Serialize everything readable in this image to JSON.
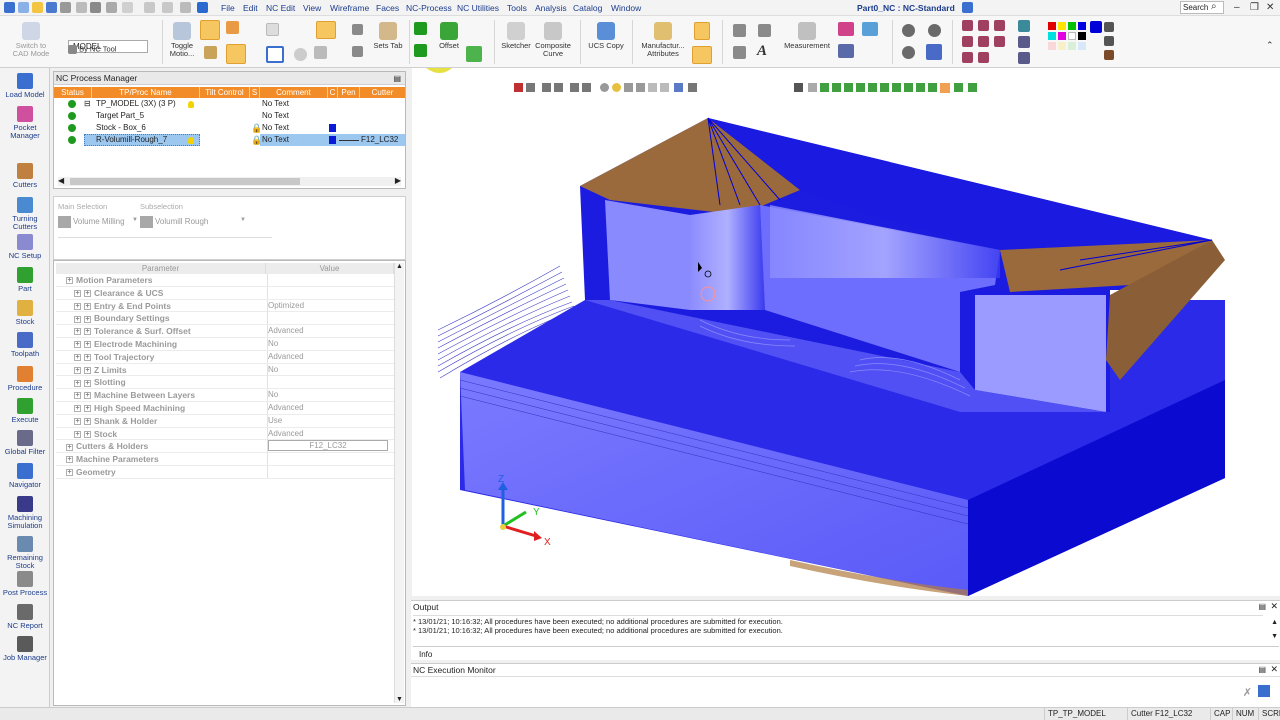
{
  "window": {
    "title": "Part0_NC : NC-Standard",
    "search_placeholder": "Search"
  },
  "menu": [
    "File",
    "Edit",
    "NC Edit",
    "View",
    "Wireframe",
    "Faces",
    "NC-Process",
    "NC Utilities",
    "Tools",
    "Analysis",
    "Catalog",
    "Window"
  ],
  "ribbon": {
    "switch_label": "Switch to CAD Mode",
    "model_combo": "MODEL",
    "by_nc_tool": "By NC Tool",
    "toggle_motion": "Toggle Motio...",
    "sets_tab": "Sets Tab",
    "offset": "Offset",
    "sketcher": "Sketcher",
    "composite_curve": "Composite Curve",
    "ucs_copy": "UCS Copy",
    "manufacturing_attributes": "Manufactur... Attributes",
    "measurement": "Measurement"
  },
  "left_toolbar": [
    {
      "label": "Load Model",
      "icon": "load-model-icon"
    },
    {
      "label": "Pocket Manager",
      "icon": "pocket-manager-icon"
    },
    {
      "label": "Cutters",
      "icon": "cutters-icon"
    },
    {
      "label": "Turning Cutters",
      "icon": "turning-cutters-icon"
    },
    {
      "label": "NC Setup",
      "icon": "nc-setup-icon"
    },
    {
      "label": "Part",
      "icon": "part-icon"
    },
    {
      "label": "Stock",
      "icon": "stock-icon"
    },
    {
      "label": "Toolpath",
      "icon": "toolpath-icon"
    },
    {
      "label": "Procedure",
      "icon": "procedure-icon"
    },
    {
      "label": "Execute",
      "icon": "execute-icon"
    },
    {
      "label": "Global Filter",
      "icon": "global-filter-icon"
    },
    {
      "label": "Navigator",
      "icon": "navigator-icon"
    },
    {
      "label": "Machining Simulation",
      "icon": "machining-simulation-icon"
    },
    {
      "label": "Remaining Stock",
      "icon": "remaining-stock-icon"
    },
    {
      "label": "Post Process",
      "icon": "post-process-icon"
    },
    {
      "label": "NC Report",
      "icon": "nc-report-icon"
    },
    {
      "label": "Job Manager",
      "icon": "job-manager-icon"
    }
  ],
  "process_manager": {
    "title": "NC Process Manager",
    "columns": [
      "Status",
      "TP/Proc Name",
      "Tilt Control",
      "S",
      "Comment",
      "C",
      "Pen",
      "Cutter"
    ],
    "rows": [
      {
        "name": "TP_MODEL (3X) (3 P)",
        "comment": "No Text",
        "cutter": ""
      },
      {
        "name": "Target Part_5",
        "comment": "No Text",
        "cutter": ""
      },
      {
        "name": "Stock - Box_6",
        "comment": "No Text",
        "cutter": ""
      },
      {
        "name": "R-Volumill-Rough_7",
        "comment": "No Text",
        "cutter": "F12_LC32"
      }
    ]
  },
  "selection": {
    "main_label": "Main Selection",
    "main_value": "Volume Milling",
    "sub_label": "Subselection",
    "sub_value": "Volumill Rough"
  },
  "params": {
    "header_param": "Parameter",
    "header_value": "Value",
    "rows": [
      {
        "name": "Motion Parameters",
        "value": "",
        "level": 0,
        "bold": true
      },
      {
        "name": "Clearance & UCS",
        "value": "",
        "level": 1,
        "bold": true
      },
      {
        "name": "Entry & End Points",
        "value": "Optimized",
        "level": 1,
        "bold": true
      },
      {
        "name": "Boundary Settings",
        "value": "",
        "level": 1,
        "bold": true
      },
      {
        "name": "Tolerance & Surf. Offset",
        "value": "Advanced",
        "level": 1,
        "bold": true
      },
      {
        "name": "Electrode Machining",
        "value": "No",
        "level": 1,
        "bold": true
      },
      {
        "name": "Tool Trajectory",
        "value": "Advanced",
        "level": 1,
        "bold": true
      },
      {
        "name": "Z Limits",
        "value": "No",
        "level": 1,
        "bold": true
      },
      {
        "name": "Slotting",
        "value": "",
        "level": 1,
        "bold": true
      },
      {
        "name": "Machine Between Layers",
        "value": "No",
        "level": 1,
        "bold": true
      },
      {
        "name": "High Speed Machining",
        "value": "Advanced",
        "level": 1,
        "bold": true
      },
      {
        "name": "Shank & Holder",
        "value": "Use",
        "level": 1,
        "bold": true
      },
      {
        "name": "Stock",
        "value": "Advanced",
        "level": 1,
        "bold": true
      },
      {
        "name": "Cutters & Holders",
        "value": "F12_LC32",
        "level": 0,
        "bold": true
      },
      {
        "name": "Machine Parameters",
        "value": "",
        "level": 0,
        "bold": true
      },
      {
        "name": "Geometry",
        "value": "",
        "level": 0,
        "bold": true
      }
    ]
  },
  "viewport": {
    "axis_x": "X",
    "axis_y": "Y",
    "axis_z": "Z"
  },
  "output": {
    "title": "Output",
    "lines": [
      "* 13/01/21; 10:16:32; All procedures have been executed; no additional procedures are submitted for execution.",
      "* 13/01/21; 10:16:32; All procedures have been executed; no additional procedures are submitted for execution."
    ],
    "tab": "Info"
  },
  "exec_monitor": {
    "title": "NC Execution Monitor"
  },
  "status": {
    "tp": "TP_TP_MODEL",
    "cutter": "Cutter F12_LC32",
    "cap": "CAP",
    "num": "NUM",
    "scrl": "SCRL"
  },
  "colors": {
    "accent": "#f28c28",
    "part_blue": "#0a0ad8",
    "stock_brown": "#9a6a3c"
  }
}
